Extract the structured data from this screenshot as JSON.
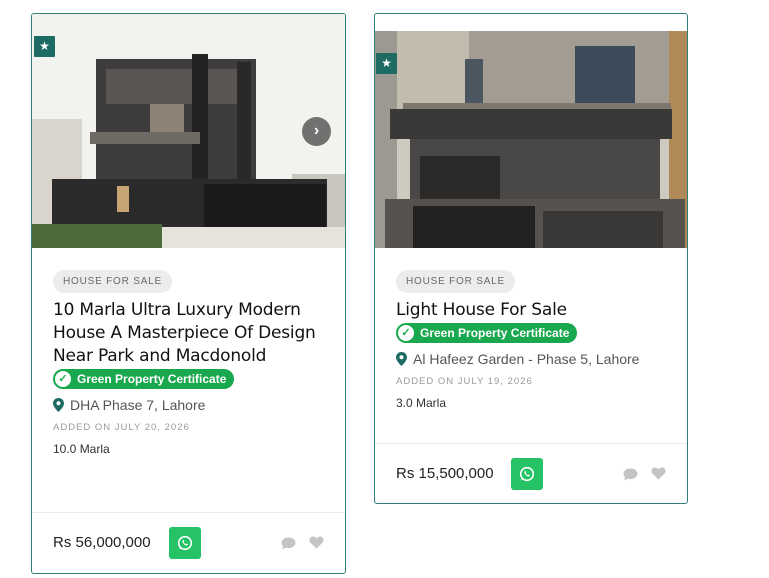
{
  "listings": [
    {
      "tag": "HOUSE FOR SALE",
      "title": "10 Marla Ultra Luxury Modern House A Masterpiece Of Design Near Park and Macdonold",
      "certificate": "Green Property Certificate",
      "location": "DHA Phase 7, Lahore",
      "added": "ADDED ON JULY 20, 2026",
      "area": "10.0 Marla",
      "price": "Rs 56,000,000",
      "featured": true,
      "has_next_arrow": true,
      "icons": {
        "featured": "star-icon",
        "next": "chevron-right-icon",
        "location": "map-pin-icon",
        "whatsapp": "whatsapp-icon",
        "comment": "chat-bubble-icon",
        "favorite": "heart-icon"
      }
    },
    {
      "tag": "HOUSE FOR SALE",
      "title": "Light House For Sale",
      "certificate": "Green Property Certificate",
      "location": "Al Hafeez Garden - Phase 5, Lahore",
      "added": "ADDED ON JULY 19, 2026",
      "area": "3.0 Marla",
      "price": "Rs 15,500,000",
      "featured": true,
      "has_next_arrow": false,
      "icons": {
        "featured": "star-icon",
        "location": "map-pin-icon",
        "whatsapp": "whatsapp-icon",
        "comment": "chat-bubble-icon",
        "favorite": "heart-icon"
      }
    }
  ],
  "colors": {
    "accent_teal": "#1d6b63",
    "border": "#2f7f78",
    "certificate_green": "#1aa84f",
    "whatsapp_green": "#25c365",
    "muted_icon": "#c4c4c4"
  }
}
